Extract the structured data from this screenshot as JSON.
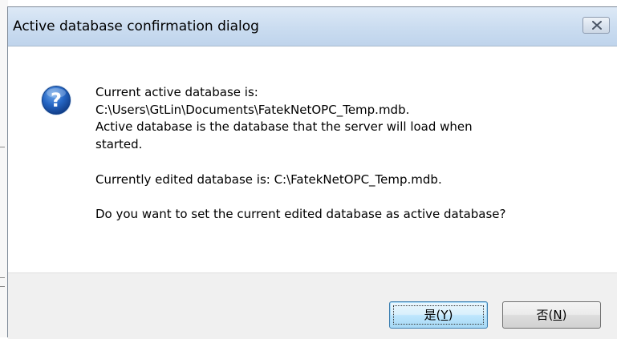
{
  "dialog": {
    "title": "Active database confirmation dialog",
    "close_icon": "close-icon",
    "question_icon": "question-icon"
  },
  "message": {
    "line1": "Current active database is:",
    "line2": "C:\\Users\\GtLin\\Documents\\FatekNetOPC_Temp.mdb.",
    "line3": "Active database is the database that the server will load when",
    "line4": "started.",
    "line5": "Currently edited database is: C:\\FatekNetOPC_Temp.mdb.",
    "line6": "Do you want to set the current edited database as active database?"
  },
  "buttons": {
    "yes": {
      "text": "是(",
      "mnemonic": "Y",
      "close": ")"
    },
    "no": {
      "text": "否(",
      "mnemonic": "N",
      "close": ")"
    }
  },
  "colors": {
    "titlebar": "#cadcf0",
    "icon_blue": "#1c5fb8",
    "default_button_border": "#3c7fb1"
  }
}
